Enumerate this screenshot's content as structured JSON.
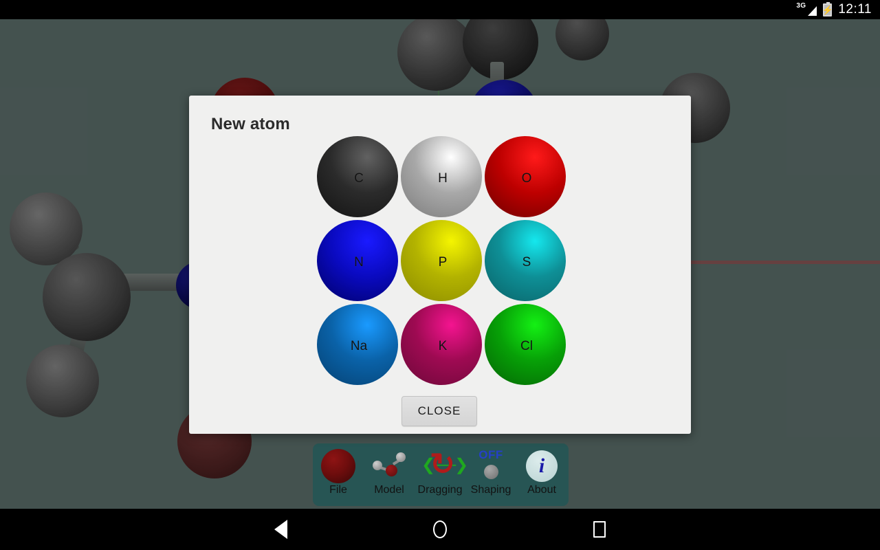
{
  "status_bar": {
    "network": "3G",
    "signal_icon": "signal-bars-icon",
    "battery_icon": "battery-charging-icon",
    "clock": "12:11"
  },
  "dialog": {
    "title": "New atom",
    "close_label": "CLOSE",
    "atoms": [
      {
        "symbol": "C",
        "base": "#2b2b2b",
        "highlight": "#616161",
        "shadow": "#121212"
      },
      {
        "symbol": "H",
        "base": "#a8a8a8",
        "highlight": "#ffffff",
        "shadow": "#7a7a7a"
      },
      {
        "symbol": "O",
        "base": "#bd0000",
        "highlight": "#ff1a1a",
        "shadow": "#6b0000"
      },
      {
        "symbol": "N",
        "base": "#0a0ac0",
        "highlight": "#1a1aff",
        "shadow": "#000066"
      },
      {
        "symbol": "P",
        "base": "#b3b300",
        "highlight": "#f5f500",
        "shadow": "#8a8a00"
      },
      {
        "symbol": "S",
        "base": "#0e8f96",
        "highlight": "#15e8ee",
        "shadow": "#0a6166"
      },
      {
        "symbol": "Na",
        "base": "#0a62a8",
        "highlight": "#1a9aff",
        "shadow": "#054070"
      },
      {
        "symbol": "K",
        "base": "#9e0a52",
        "highlight": "#f41490",
        "shadow": "#6b0838"
      },
      {
        "symbol": "Cl",
        "base": "#07a007",
        "highlight": "#14f014",
        "shadow": "#046404"
      }
    ]
  },
  "toolbar": {
    "items": [
      {
        "label": "File",
        "icon": "red-sphere-icon"
      },
      {
        "label": "Model",
        "icon": "water-molecule-icon"
      },
      {
        "label": "Dragging",
        "icon": "rotation-arrows-icon"
      },
      {
        "label": "Shaping",
        "icon": "toggle-dot-icon",
        "state": "OFF"
      },
      {
        "label": "About",
        "icon": "info-icon"
      }
    ]
  },
  "nav_bar": {
    "back": "back-icon",
    "home": "home-icon",
    "recents": "recents-icon"
  },
  "scene": {
    "background_color": "#546461",
    "x_axis_color": "#7d4f4f",
    "y_axis_color": "#4e7a52"
  }
}
